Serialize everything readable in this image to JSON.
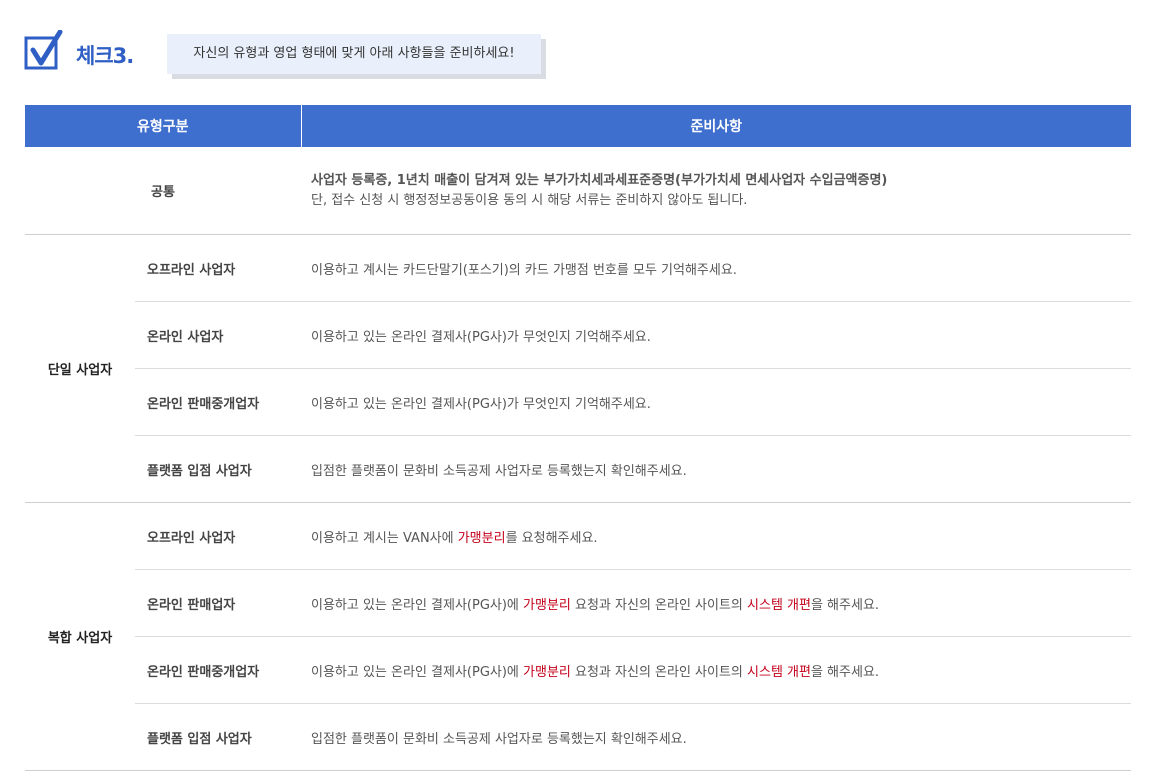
{
  "header": {
    "check_title": "체크3.",
    "banner_text": "자신의 유형과 영업 형태에 맞게 아래 사항들을 준비하세요!"
  },
  "table": {
    "col_type": "유형구분",
    "col_prep": "준비사항",
    "common": {
      "label": "공통",
      "line1": "사업자 등록증, 1년치 매출이 담겨져 있는 부가가치세과세표준증명(부가가치세 면세사업자 수입금액증명)",
      "line2": "단, 접수 신청 시 행정정보공동이용 동의 시 해당 서류는 준비하지 않아도 됩니다."
    },
    "single": {
      "label": "단일 사업자",
      "rows": [
        {
          "type": "오프라인 사업자",
          "desc": "이용하고 계시는 카드단말기(포스기)의 카드 가맹점 번호를 모두 기억해주세요."
        },
        {
          "type": "온라인 사업자",
          "desc": "이용하고 있는 온라인 결제사(PG사)가 무엇인지 기억해주세요."
        },
        {
          "type": "온라인 판매중개업자",
          "desc": "이용하고 있는 온라인 결제사(PG사)가 무엇인지 기억해주세요."
        },
        {
          "type": "플랫폼 입점 사업자",
          "desc": "입점한 플랫폼이 문화비 소득공제 사업자로 등록했는지 확인해주세요."
        }
      ]
    },
    "compound": {
      "label": "복합 사업자",
      "rows": [
        {
          "type": "오프라인 사업자",
          "desc_a": "이용하고 계시는 VAN사에 ",
          "hl_1": "가맹분리",
          "desc_b": "를 요청해주세요."
        },
        {
          "type": "온라인 판매업자",
          "desc_a": "이용하고 있는 온라인 결제사(PG사)에 ",
          "hl_1": "가맹분리",
          "desc_b": " 요청과 자신의 온라인 사이트의 ",
          "hl_2": "시스템 개편",
          "desc_c": "을 해주세요."
        },
        {
          "type": "온라인 판매중개업자",
          "desc_a": "이용하고 있는 온라인 결제사(PG사)에 ",
          "hl_1": "가맹분리",
          "desc_b": " 요청과 자신의 온라인 사이트의 ",
          "hl_2": "시스템 개편",
          "desc_c": "을 해주세요."
        },
        {
          "type": "플랫폼 입점 사업자",
          "desc": "입점한 플랫폼이 문화비 소득공제 사업자로 등록했는지 확인해주세요."
        }
      ]
    }
  },
  "colors": {
    "header_blue": "#3f6fce",
    "title_blue": "#2f5fc4",
    "highlight_red": "#c4001a",
    "banner_bg": "#e9f0fb"
  },
  "icons": {
    "check": "checkbox-check-icon"
  }
}
